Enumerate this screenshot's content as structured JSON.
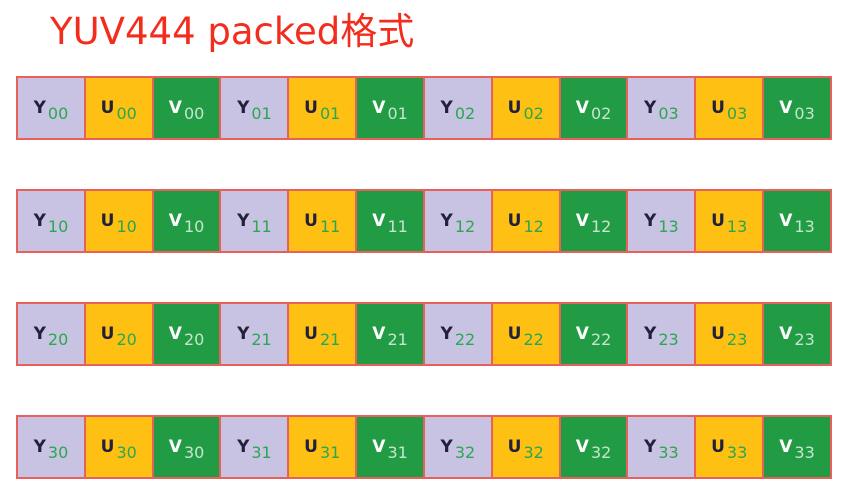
{
  "title": "YUV444 packed格式",
  "colors": {
    "y_fill": "#c8c3e2",
    "u_fill": "#fec012",
    "v_fill": "#229b45",
    "cell_border": "#e8605a",
    "title_text": "#f32d1d",
    "index_text": "#2aa74f"
  },
  "rows": [
    {
      "cells": [
        {
          "component": "Y",
          "letter": "Y",
          "index": "00"
        },
        {
          "component": "U",
          "letter": "U",
          "index": "00"
        },
        {
          "component": "V",
          "letter": "V",
          "index": "00"
        },
        {
          "component": "Y",
          "letter": "Y",
          "index": "01"
        },
        {
          "component": "U",
          "letter": "U",
          "index": "01"
        },
        {
          "component": "V",
          "letter": "V",
          "index": "01"
        },
        {
          "component": "Y",
          "letter": "Y",
          "index": "02"
        },
        {
          "component": "U",
          "letter": "U",
          "index": "02"
        },
        {
          "component": "V",
          "letter": "V",
          "index": "02"
        },
        {
          "component": "Y",
          "letter": "Y",
          "index": "03"
        },
        {
          "component": "U",
          "letter": "U",
          "index": "03"
        },
        {
          "component": "V",
          "letter": "V",
          "index": "03"
        }
      ]
    },
    {
      "cells": [
        {
          "component": "Y",
          "letter": "Y",
          "index": "10"
        },
        {
          "component": "U",
          "letter": "U",
          "index": "10"
        },
        {
          "component": "V",
          "letter": "V",
          "index": "10"
        },
        {
          "component": "Y",
          "letter": "Y",
          "index": "11"
        },
        {
          "component": "U",
          "letter": "U",
          "index": "11"
        },
        {
          "component": "V",
          "letter": "V",
          "index": "11"
        },
        {
          "component": "Y",
          "letter": "Y",
          "index": "12"
        },
        {
          "component": "U",
          "letter": "U",
          "index": "12"
        },
        {
          "component": "V",
          "letter": "V",
          "index": "12"
        },
        {
          "component": "Y",
          "letter": "Y",
          "index": "13"
        },
        {
          "component": "U",
          "letter": "U",
          "index": "13"
        },
        {
          "component": "V",
          "letter": "V",
          "index": "13"
        }
      ]
    },
    {
      "cells": [
        {
          "component": "Y",
          "letter": "Y",
          "index": "20"
        },
        {
          "component": "U",
          "letter": "U",
          "index": "20"
        },
        {
          "component": "V",
          "letter": "V",
          "index": "20"
        },
        {
          "component": "Y",
          "letter": "Y",
          "index": "21"
        },
        {
          "component": "U",
          "letter": "U",
          "index": "21"
        },
        {
          "component": "V",
          "letter": "V",
          "index": "21"
        },
        {
          "component": "Y",
          "letter": "Y",
          "index": "22"
        },
        {
          "component": "U",
          "letter": "U",
          "index": "22"
        },
        {
          "component": "V",
          "letter": "V",
          "index": "22"
        },
        {
          "component": "Y",
          "letter": "Y",
          "index": "23"
        },
        {
          "component": "U",
          "letter": "U",
          "index": "23"
        },
        {
          "component": "V",
          "letter": "V",
          "index": "23"
        }
      ]
    },
    {
      "cells": [
        {
          "component": "Y",
          "letter": "Y",
          "index": "30"
        },
        {
          "component": "U",
          "letter": "U",
          "index": "30"
        },
        {
          "component": "V",
          "letter": "V",
          "index": "30"
        },
        {
          "component": "Y",
          "letter": "Y",
          "index": "31"
        },
        {
          "component": "U",
          "letter": "U",
          "index": "31"
        },
        {
          "component": "V",
          "letter": "V",
          "index": "31"
        },
        {
          "component": "Y",
          "letter": "Y",
          "index": "32"
        },
        {
          "component": "U",
          "letter": "U",
          "index": "32"
        },
        {
          "component": "V",
          "letter": "V",
          "index": "32"
        },
        {
          "component": "Y",
          "letter": "Y",
          "index": "33"
        },
        {
          "component": "U",
          "letter": "U",
          "index": "33"
        },
        {
          "component": "V",
          "letter": "V",
          "index": "33"
        }
      ]
    }
  ]
}
